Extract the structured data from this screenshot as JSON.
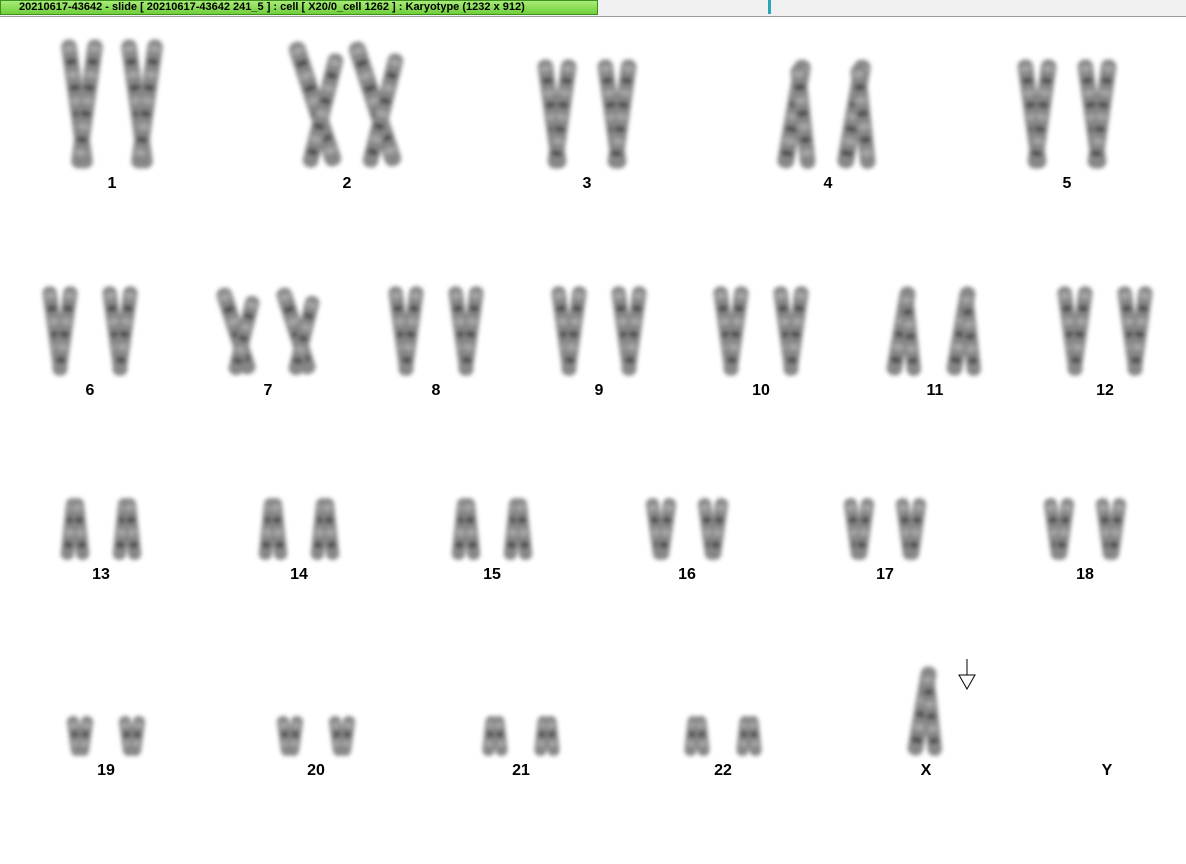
{
  "window": {
    "title": "20210617-43642 - slide [ 20210617-43642 241_5 ] : cell [ X20/0_cell 1262 ] : Karyotype  (1232 x 912)"
  },
  "karyotype": {
    "rows": [
      {
        "chromosomes": [
          {
            "label": "1",
            "count": 2,
            "size": "xl",
            "shape": "x"
          },
          {
            "label": "2",
            "count": 2,
            "size": "xl",
            "shape": "curl"
          },
          {
            "label": "3",
            "count": 2,
            "size": "l",
            "shape": "x"
          },
          {
            "label": "4",
            "count": 2,
            "size": "l",
            "shape": "bend"
          },
          {
            "label": "5",
            "count": 2,
            "size": "l",
            "shape": "x"
          }
        ]
      },
      {
        "chromosomes": [
          {
            "label": "6",
            "count": 2,
            "size": "m",
            "shape": "x"
          },
          {
            "label": "7",
            "count": 2,
            "size": "m",
            "shape": "curl"
          },
          {
            "label": "8",
            "count": 2,
            "size": "m",
            "shape": "x"
          },
          {
            "label": "9",
            "count": 2,
            "size": "m",
            "shape": "x"
          },
          {
            "label": "10",
            "count": 2,
            "size": "m",
            "shape": "x"
          },
          {
            "label": "11",
            "count": 2,
            "size": "m",
            "shape": "bend"
          },
          {
            "label": "12",
            "count": 2,
            "size": "m",
            "shape": "x"
          }
        ]
      },
      {
        "chromosomes": [
          {
            "label": "13",
            "count": 2,
            "size": "s",
            "shape": "acro"
          },
          {
            "label": "14",
            "count": 2,
            "size": "s",
            "shape": "acro"
          },
          {
            "label": "15",
            "count": 2,
            "size": "s",
            "shape": "acro"
          },
          {
            "label": "16",
            "count": 2,
            "size": "s",
            "shape": "x"
          },
          {
            "label": "17",
            "count": 2,
            "size": "s",
            "shape": "x"
          },
          {
            "label": "18",
            "count": 2,
            "size": "s",
            "shape": "x"
          }
        ]
      },
      {
        "chromosomes": [
          {
            "label": "19",
            "count": 2,
            "size": "xs",
            "shape": "x"
          },
          {
            "label": "20",
            "count": 2,
            "size": "xs",
            "shape": "x"
          },
          {
            "label": "21",
            "count": 2,
            "size": "xs",
            "shape": "acro"
          },
          {
            "label": "22",
            "count": 2,
            "size": "xs",
            "shape": "acro"
          },
          {
            "label": "X",
            "count": 1,
            "size": "m",
            "shape": "bend",
            "flagged": true
          },
          {
            "label": "Y",
            "count": 0,
            "size": "s",
            "shape": "x"
          }
        ]
      }
    ]
  },
  "icons": {
    "flag_marker": "down-arrow-icon"
  },
  "colors": {
    "title_bar_green": "#6fcf3a",
    "chromosome_ink": "#5a5a5a",
    "background": "#ffffff"
  }
}
